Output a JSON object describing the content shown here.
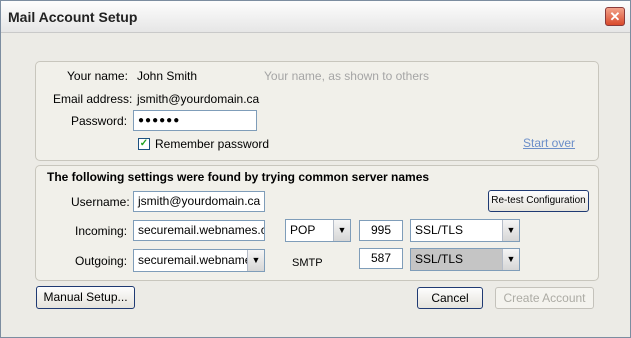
{
  "window": {
    "title": "Mail Account Setup",
    "close_glyph": "✕"
  },
  "account": {
    "name_label": "Your name:",
    "name_value": "John Smith",
    "name_hint": "Your name, as shown to others",
    "email_label": "Email address:",
    "email_value": "jsmith@yourdomain.ca",
    "password_label": "Password:",
    "password_value": "●●●●●●",
    "remember_label": "Remember password",
    "remember_checked": true,
    "start_over": "Start over"
  },
  "settings": {
    "heading": "The following settings were found by trying common server names",
    "username_label": "Username:",
    "username_value": "jsmith@yourdomain.ca",
    "retest_button": "Re-test Configuration",
    "incoming_label": "Incoming:",
    "incoming_server": "securemail.webnames.ca",
    "incoming_protocol": "POP",
    "incoming_port": "995",
    "incoming_security": "SSL/TLS",
    "outgoing_label": "Outgoing:",
    "outgoing_server": "securemail.webnames.ca",
    "outgoing_protocol": "SMTP",
    "outgoing_port": "587",
    "outgoing_security": "SSL/TLS"
  },
  "footer": {
    "manual_setup": "Manual Setup...",
    "cancel": "Cancel",
    "create_account": "Create Account"
  },
  "colors": {
    "link": "#6c8fc9",
    "disabled_text": "#acaba4",
    "hint": "#a5a5a5"
  }
}
